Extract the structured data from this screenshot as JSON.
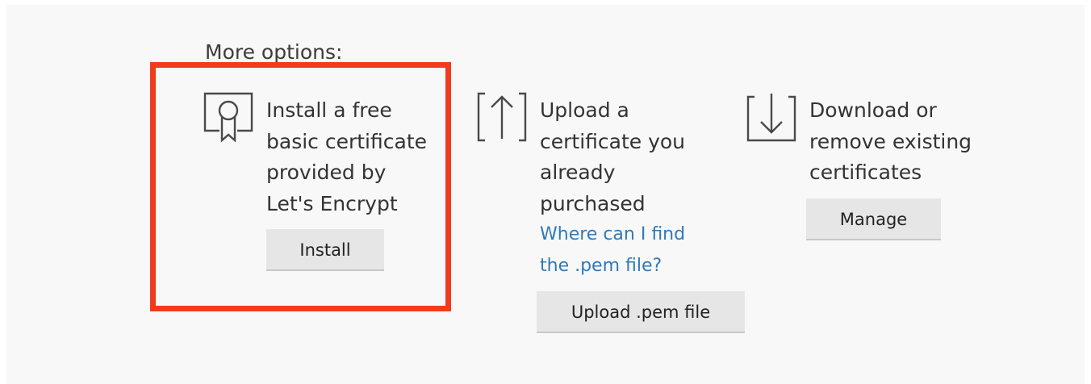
{
  "more_options_label": "More options:",
  "options": [
    {
      "id": "letsencrypt",
      "icon": "certificate-ribbon-icon",
      "lines": [
        "Install a free",
        "basic certificate",
        "provided by",
        "Let's Encrypt"
      ],
      "button_label": "Install"
    },
    {
      "id": "upload",
      "icon": "upload-arrow-icon",
      "lines": [
        "Upload a",
        "certificate you",
        "already",
        "purchased"
      ],
      "link_lines": [
        "Where can I find",
        "the .pem file?"
      ],
      "button_label": "Upload .pem file"
    },
    {
      "id": "manage",
      "icon": "download-arrow-icon",
      "lines": [
        "Download or",
        "remove existing",
        "certificates"
      ],
      "button_label": "Manage"
    }
  ],
  "colors": {
    "highlight": "#f03c1d",
    "link": "#2f7ab9",
    "button_bg": "#e6e6e6",
    "panel_bg": "#f8f8f8"
  }
}
